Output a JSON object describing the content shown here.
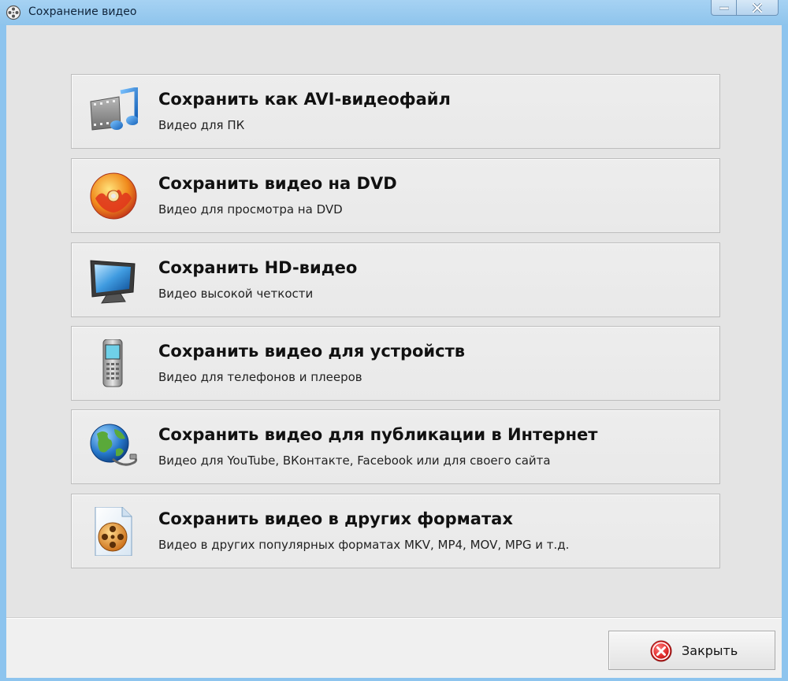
{
  "window": {
    "title": "Сохранение видео"
  },
  "options": [
    {
      "title": "Сохранить как AVI-видеофайл",
      "subtitle": "Видео для ПК",
      "icon": "film-music-icon"
    },
    {
      "title": "Сохранить видео на DVD",
      "subtitle": "Видео для просмотра на DVD",
      "icon": "dvd-disc-icon"
    },
    {
      "title": "Сохранить HD-видео",
      "subtitle": "Видео высокой четкости",
      "icon": "monitor-icon"
    },
    {
      "title": "Сохранить видео для устройств",
      "subtitle": "Видео для телефонов и плееров",
      "icon": "mobile-phone-icon"
    },
    {
      "title": "Сохранить видео для публикации в Интернет",
      "subtitle": "Видео для YouTube, ВКонтакте, Facebook или для своего сайта",
      "icon": "globe-icon"
    },
    {
      "title": "Сохранить видео в других форматах",
      "subtitle": "Видео в других популярных форматах MKV, MP4, MOV, MPG и т.д.",
      "icon": "film-reel-file-icon"
    }
  ],
  "footer": {
    "close_label": "Закрыть",
    "close_icon": "close-circle-icon"
  },
  "colors": {
    "titlebar": "#8ec4ec",
    "content_bg": "#e4e4e4",
    "close_red": "#d8232a"
  }
}
